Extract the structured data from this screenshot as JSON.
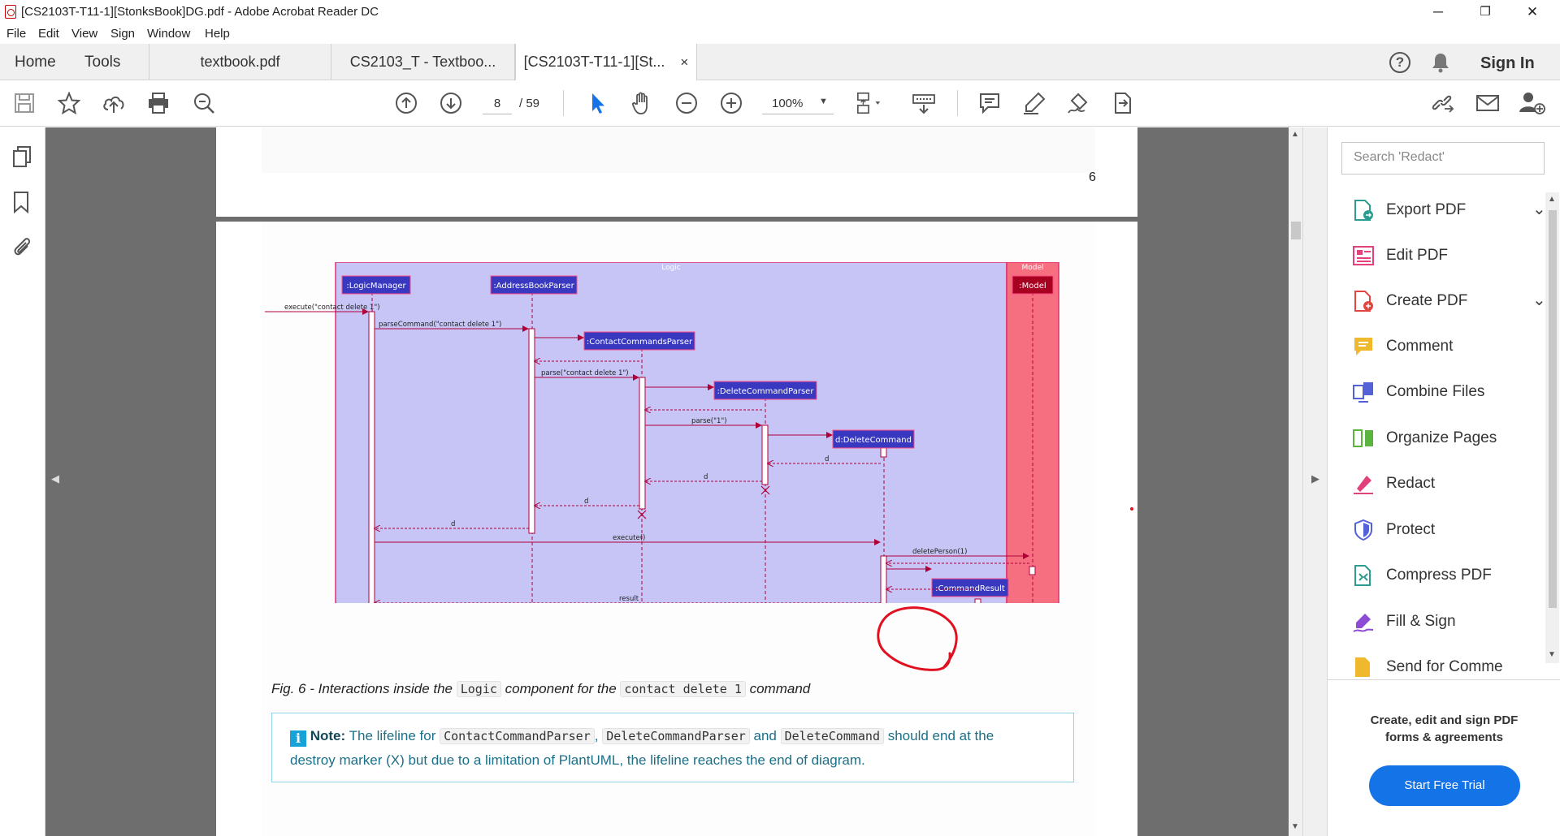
{
  "window": {
    "title": "[CS2103T-T11-1][StonksBook]DG.pdf - Adobe Acrobat Reader DC",
    "minimize": "─",
    "restore": "❐",
    "close": "✕"
  },
  "menu": [
    "File",
    "Edit",
    "View",
    "Sign",
    "Window",
    "Help"
  ],
  "tabs": {
    "home": "Home",
    "tools": "Tools",
    "docs": [
      {
        "label": "textbook.pdf"
      },
      {
        "label": "CS2103_T - Textboo..."
      },
      {
        "label": "[CS2103T-T11-1][St...",
        "close": "×"
      }
    ],
    "sign_in": "Sign In"
  },
  "toolbar": {
    "page_current": "8",
    "page_total": "/ 59",
    "zoom": "100%"
  },
  "page_prev": {
    "number": "6"
  },
  "diagram": {
    "logic_frame": "Logic",
    "model_frame": "Model",
    "participants": [
      ":LogicManager",
      ":AddressBookParser",
      ":ContactCommandsParser",
      ":DeleteCommandParser",
      "d:DeleteCommand",
      ":CommandResult",
      ":Model"
    ],
    "messages": {
      "execute_call": "execute(\"contact delete 1\")",
      "parse_command": "parseCommand(\"contact delete 1\")",
      "parse": "parse(\"contact delete 1\")",
      "parse_1": "parse(\"1\")",
      "d1": "d",
      "d2": "d",
      "d3": "d",
      "d4": "d",
      "execute": "execute()",
      "delete_person": "deletePerson(1)",
      "result": "result"
    }
  },
  "caption": {
    "prefix": "Fig. 6 - Interactions inside the ",
    "code1": "Logic",
    "middle": " component for the ",
    "code2": "contact delete 1",
    "suffix": " command"
  },
  "note": {
    "label": "Note:",
    "t1": " The lifeline for ",
    "c1": "ContactCommandParser",
    "t2": ", ",
    "c2": "DeleteCommandParser",
    "t3": " and ",
    "c3": "DeleteCommand",
    "t4": " should end at the",
    "line2": "destroy marker (X) but due to a limitation of PlantUML, the lifeline reaches the end of diagram."
  },
  "right_panel": {
    "search_placeholder": "Search 'Redact'",
    "tools": [
      {
        "label": "Export PDF",
        "icon": "export-pdf-icon",
        "color": "#2b9c8f"
      },
      {
        "label": "Edit PDF",
        "icon": "edit-pdf-icon",
        "color": "#e3417b"
      },
      {
        "label": "Create PDF",
        "icon": "create-pdf-icon",
        "color": "#e0463e"
      },
      {
        "label": "Comment",
        "icon": "comment-icon",
        "color": "#f0b82c"
      },
      {
        "label": "Combine Files",
        "icon": "combine-files-icon",
        "color": "#5561d6"
      },
      {
        "label": "Organize Pages",
        "icon": "organize-pages-icon",
        "color": "#5ab43f"
      },
      {
        "label": "Redact",
        "icon": "redact-icon",
        "color": "#e3417b"
      },
      {
        "label": "Protect",
        "icon": "protect-icon",
        "color": "#5561d6"
      },
      {
        "label": "Compress PDF",
        "icon": "compress-pdf-icon",
        "color": "#2b9c8f"
      },
      {
        "label": "Fill & Sign",
        "icon": "fill-sign-icon",
        "color": "#8e4bd6"
      },
      {
        "label": "Send for Comme",
        "icon": "send-comment-icon",
        "color": "#f0b82c"
      }
    ],
    "promo": "Create, edit and sign PDF forms & agreements",
    "trial_button": "Start Free Trial"
  },
  "colors": {
    "accent": "#1473e6",
    "diagram_logic_bg": "#c7c5f5",
    "diagram_model_bg": "#f66f80",
    "diagram_line": "#b0003a",
    "participant_box": "#3838c0",
    "model_box": "#a80020",
    "annotation": "#e01020"
  }
}
